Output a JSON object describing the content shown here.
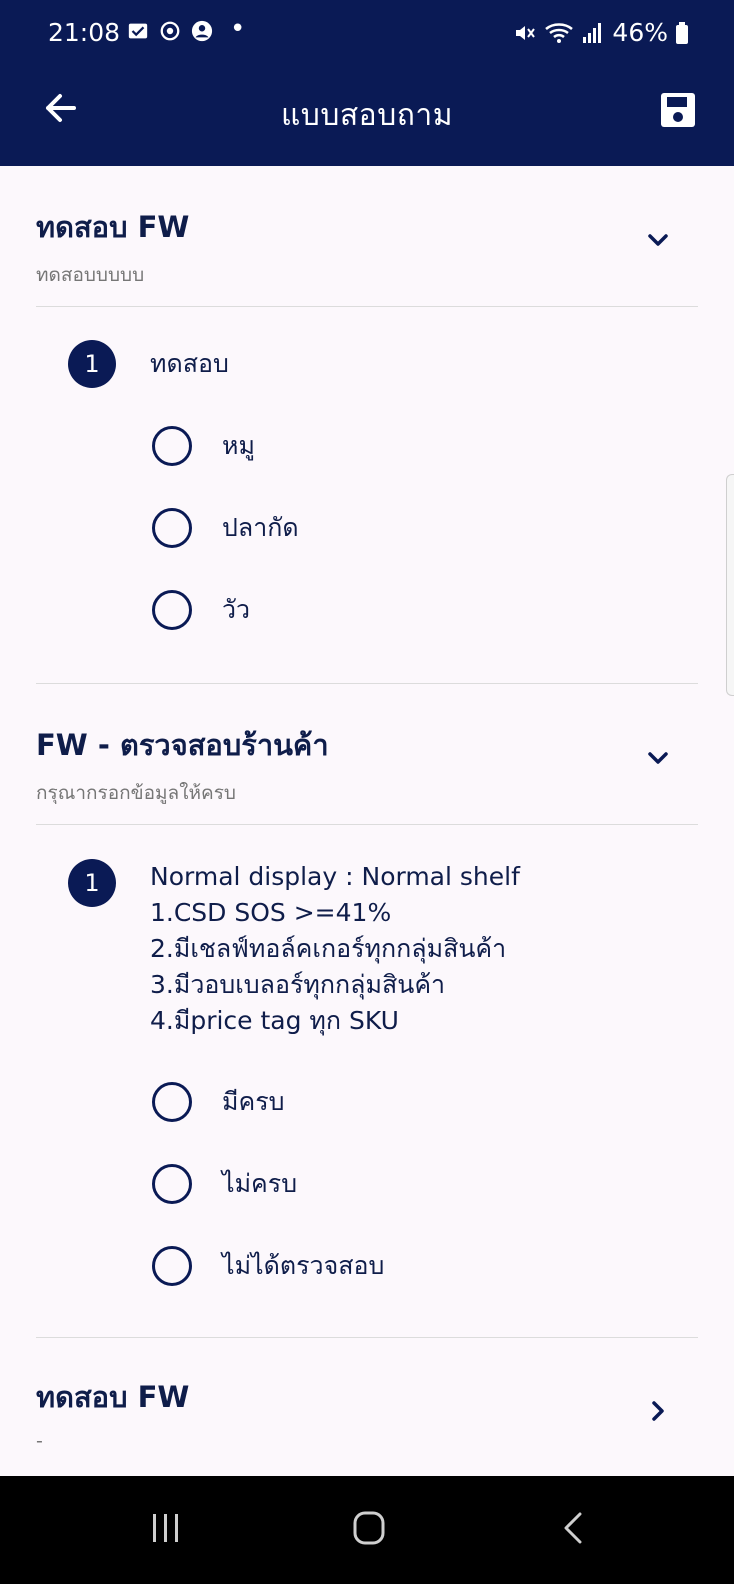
{
  "status_bar": {
    "time": "21:08",
    "battery": "46%",
    "icons": [
      "gmail-check-icon",
      "sync-icon",
      "account-icon",
      "mute-icon",
      "wifi-icon",
      "signal-icon",
      "battery-icon"
    ]
  },
  "app_bar": {
    "title": "แบบสอบถาม",
    "back_icon": "arrow-left-icon",
    "save_icon": "save-icon"
  },
  "sections": [
    {
      "title": "ทดสอบ FW",
      "subtitle": "ทดสอบบบบบ",
      "expanded": true,
      "questions": [
        {
          "number": "1",
          "text": "ทดสอบ",
          "options": [
            "หมู",
            "ปลากัด",
            "วัว"
          ]
        }
      ]
    },
    {
      "title": "FW - ตรวจสอบร้านค้า",
      "subtitle": "กรุณากรอกข้อมูลให้ครบ",
      "expanded": true,
      "questions": [
        {
          "number": "1",
          "text_lines": [
            "Normal display : Normal shelf",
            "1.CSD SOS >=41%",
            "2.มีเชลฟ์ทอล์คเกอร์ทุกกลุ่มสินค้า",
            "3.มีวอบเบลอร์ทุกกลุ่มสินค้า",
            "4.มีprice tag ทุก SKU"
          ],
          "options": [
            "มีครบ",
            "ไม่ครบ",
            "ไม่ได้ตรวจสอบ"
          ]
        }
      ]
    },
    {
      "title": "ทดสอบ FW",
      "subtitle": "-",
      "expanded": false
    }
  ],
  "colors": {
    "primary": "#0a1a55",
    "background": "#fcf8fc",
    "subtitle": "#767676",
    "divider": "#dcdcdc"
  }
}
